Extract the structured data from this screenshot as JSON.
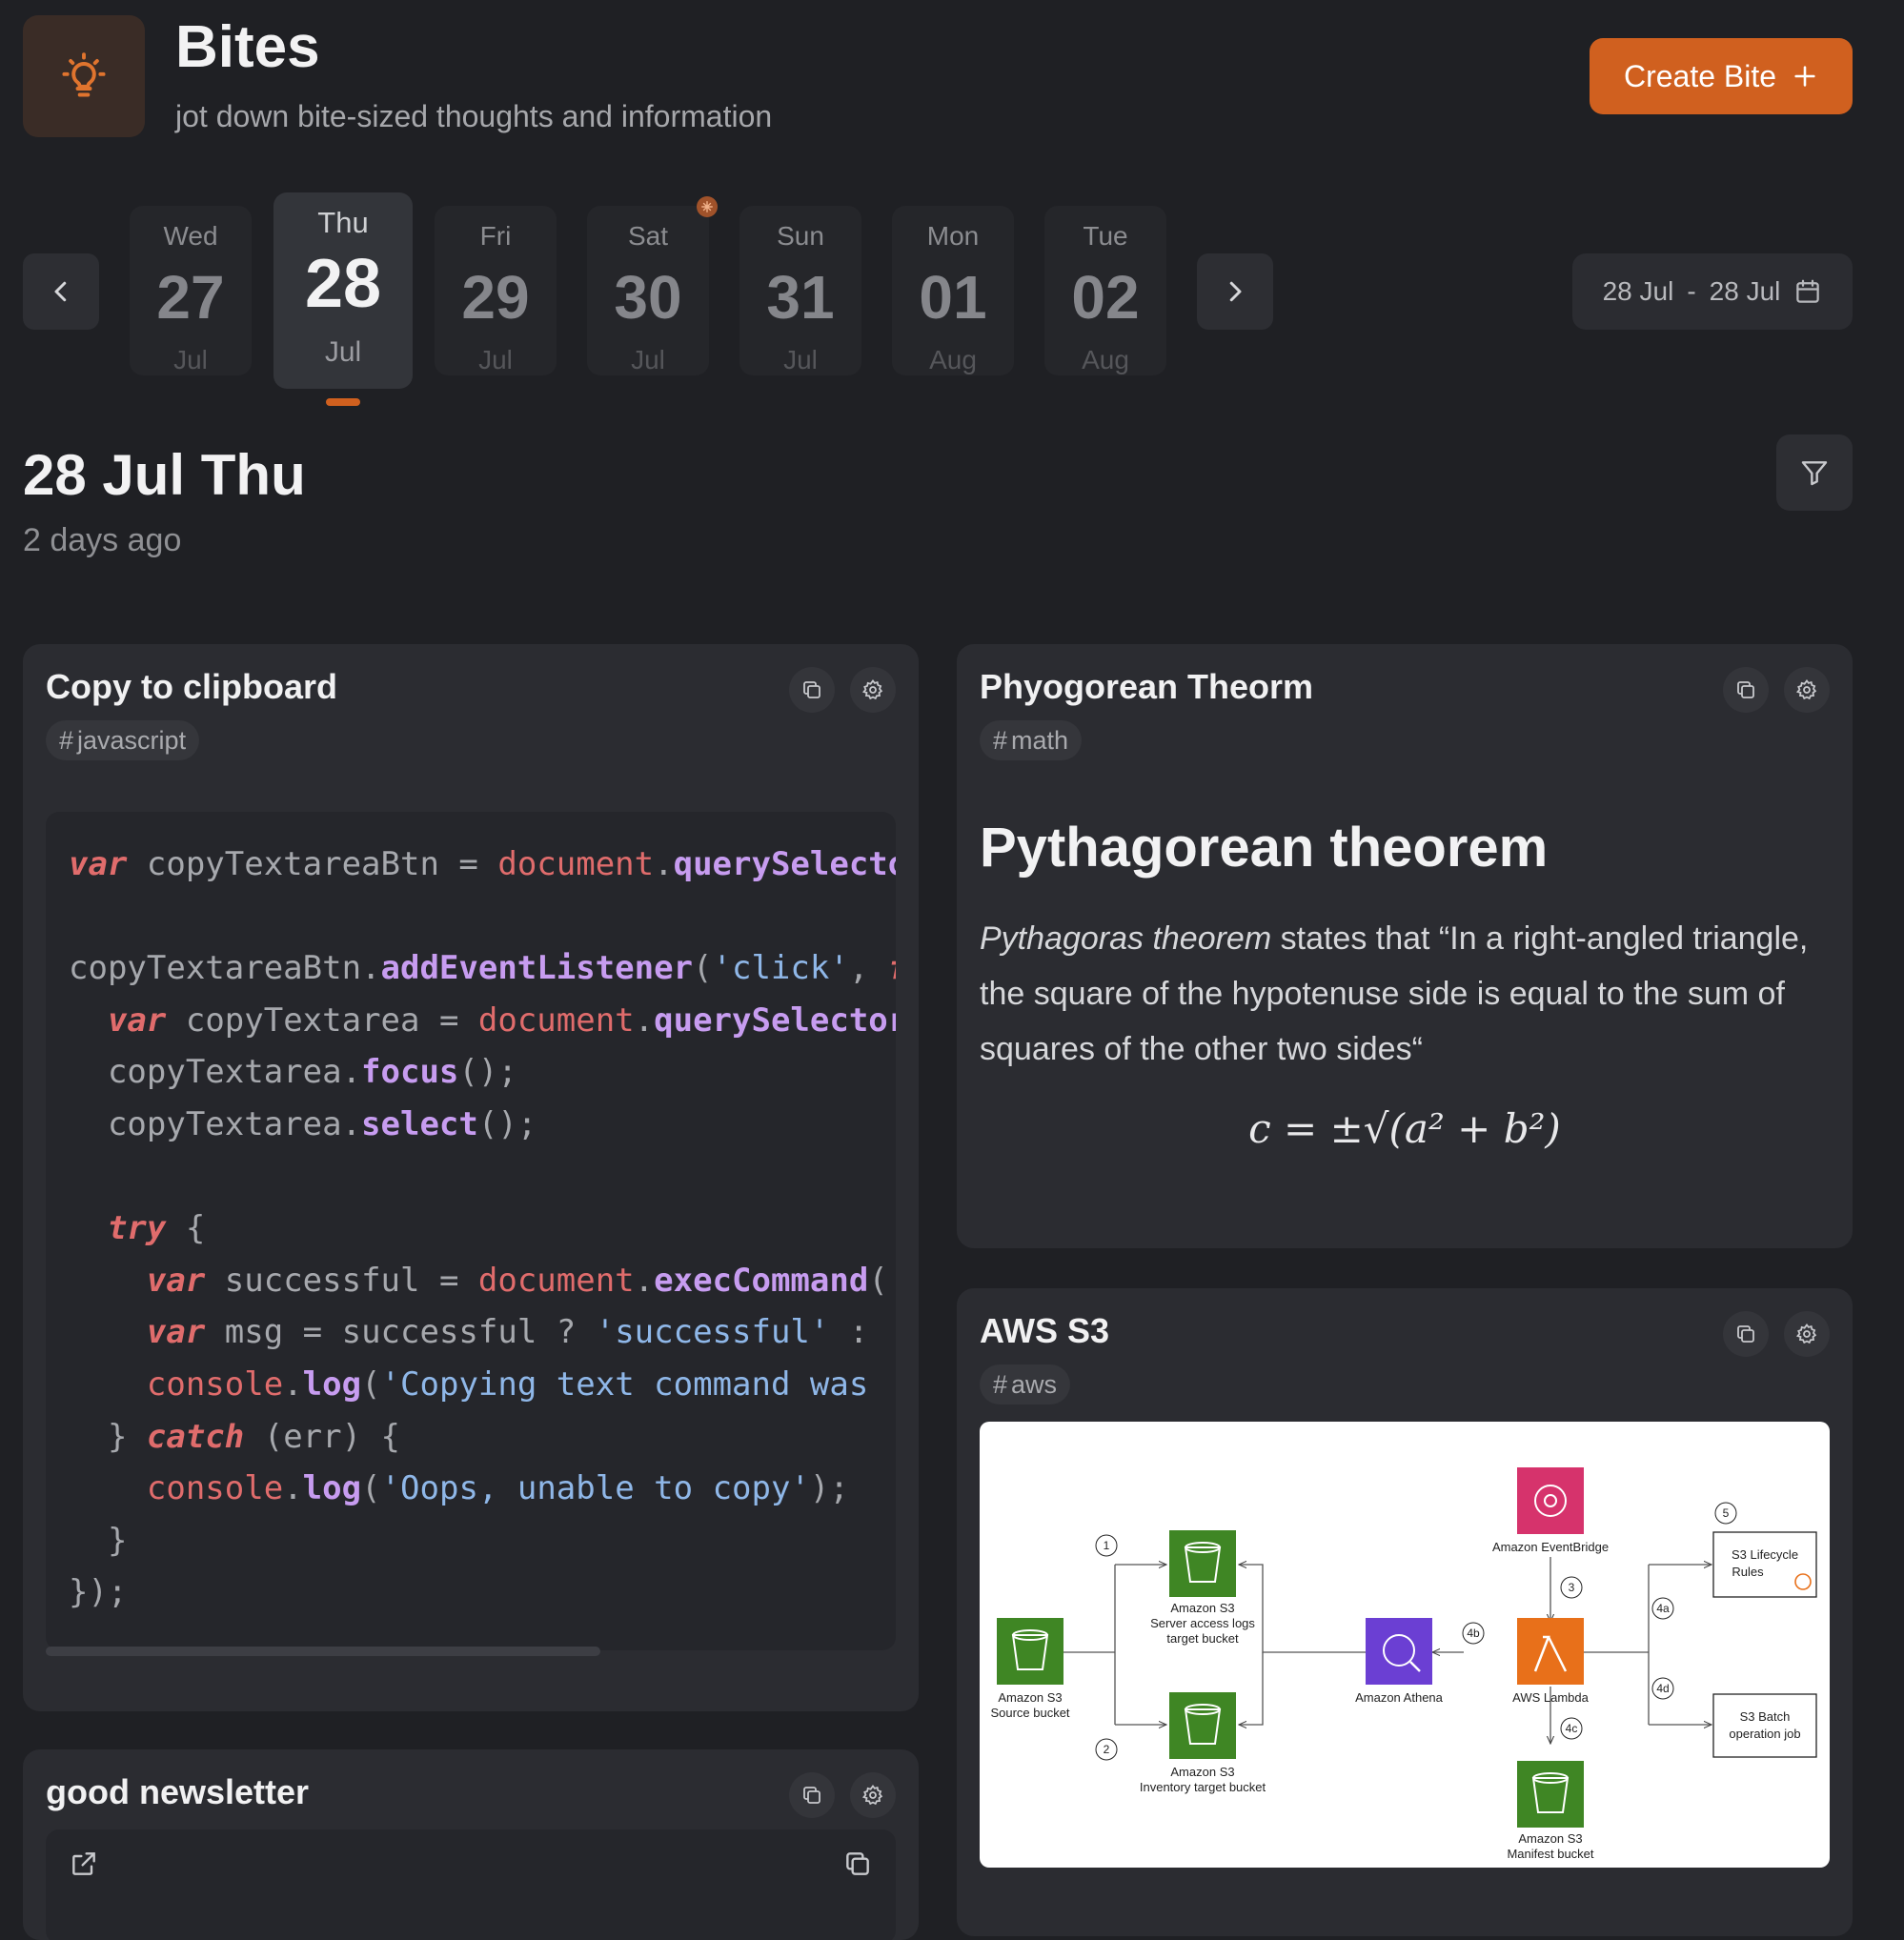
{
  "app": {
    "title": "Bites",
    "subtitle": "jot down bite-sized thoughts and information",
    "create_label": "Create Bite",
    "accent": "#d0601f"
  },
  "dates": [
    {
      "day": "Wed",
      "num": "27",
      "mon": "Jul"
    },
    {
      "day": "Thu",
      "num": "28",
      "mon": "Jul",
      "selected": true
    },
    {
      "day": "Fri",
      "num": "29",
      "mon": "Jul"
    },
    {
      "day": "Sat",
      "num": "30",
      "mon": "Jul",
      "has_dot": true
    },
    {
      "day": "Sun",
      "num": "31",
      "mon": "Jul"
    },
    {
      "day": "Mon",
      "num": "01",
      "mon": "Aug"
    },
    {
      "day": "Tue",
      "num": "02",
      "mon": "Aug"
    }
  ],
  "range": {
    "from": "28 Jul",
    "sep": "-",
    "to": "28 Jul"
  },
  "heading": {
    "title": "28 Jul Thu",
    "relative": "2 days ago"
  },
  "cards": {
    "clipboard": {
      "title": "Copy to clipboard",
      "tag": "javascript"
    },
    "pythag": {
      "title": "Phyogorean Theorm",
      "tag": "math",
      "h1": "Pythagorean theorem",
      "em": "Pythagoras theorem",
      "text": " states that “In a right-angled triangle, the square of the hypotenuse side is equal to the sum of squares of the other two sides“",
      "formula": "c = ±√(a² + b²)"
    },
    "s3": {
      "title": "AWS S3",
      "tag": "aws",
      "diagram": {
        "source": [
          "Amazon S3",
          "Source bucket"
        ],
        "logs": [
          "Amazon S3",
          "Server access logs",
          "target bucket"
        ],
        "inventory": [
          "Amazon S3",
          "Inventory target bucket"
        ],
        "athena": "Amazon Athena",
        "eventbridge": "Amazon EventBridge",
        "lambda": "AWS Lambda",
        "manifest": [
          "Amazon S3",
          "Manifest bucket"
        ],
        "lifecycle": [
          "S3 Lifecycle",
          "Rules"
        ],
        "batch": [
          "S3 Batch",
          "operation job"
        ],
        "steps": [
          "1",
          "2",
          "3",
          "4a",
          "4b",
          "4c",
          "4d",
          "5"
        ]
      }
    },
    "newsletter": {
      "title": "good newsletter"
    }
  }
}
